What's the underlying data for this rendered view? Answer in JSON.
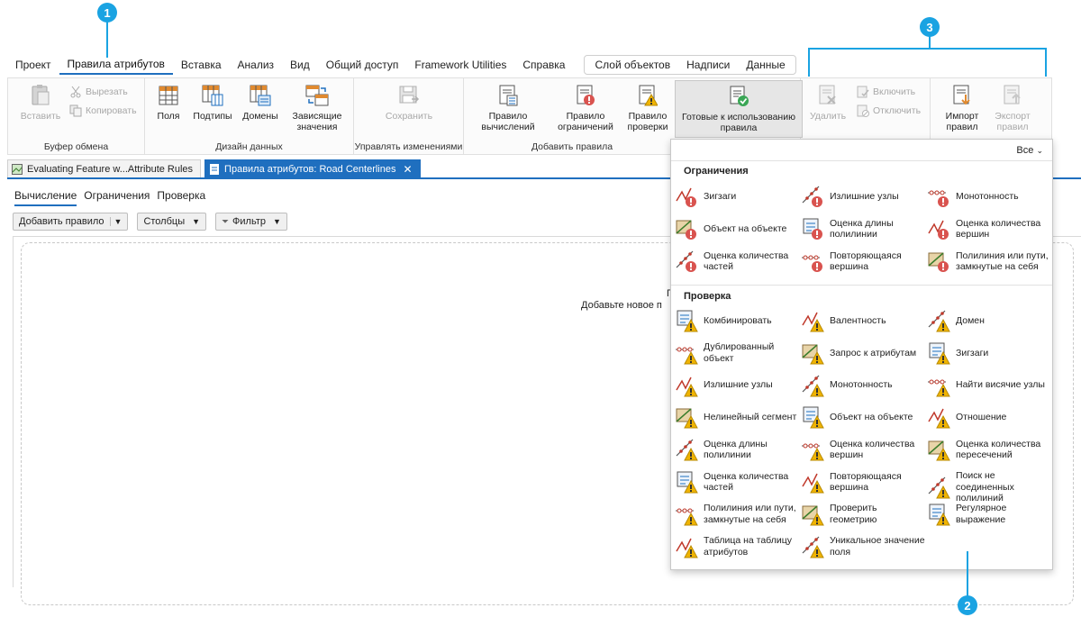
{
  "callouts": [
    "1",
    "2",
    "3"
  ],
  "menu": {
    "items": [
      "Проект",
      "Правила атрибутов",
      "Вставка",
      "Анализ",
      "Вид",
      "Общий доступ",
      "Framework Utilities",
      "Справка"
    ],
    "contextual": [
      "Слой объектов",
      "Надписи",
      "Данные"
    ]
  },
  "ribbon": {
    "clipboard": {
      "label": "Буфер обмена",
      "paste": "Вставить",
      "cut": "Вырезать",
      "copy": "Копировать"
    },
    "data_design": {
      "label": "Дизайн данных",
      "fields": "Поля",
      "subtypes": "Подтипы",
      "domains": "Домены",
      "dependent": "Зависящие значения"
    },
    "manage": {
      "label": "Управлять изменениями",
      "save": "Сохранить"
    },
    "add_rules": {
      "label": "Добавить правила",
      "calc": "Правило вычислений",
      "constraint": "Правило ограничений",
      "validation": "Правило проверки",
      "ready": "Готовые к использованию правила"
    },
    "edit": {
      "delete": "Удалить",
      "enable": "Включить",
      "disable": "Отключить"
    },
    "io": {
      "import": "Импорт правил",
      "export": "Экспорт правил"
    }
  },
  "doc_tabs": [
    "Evaluating Feature w...Attribute Rules",
    "Правила атрибутов: Road Centerlines"
  ],
  "sub_tabs": [
    "Вычисление",
    "Ограничения",
    "Проверка"
  ],
  "toolbar": {
    "add_rule": "Добавить правило",
    "columns": "Столбцы",
    "filter": "Фильтр"
  },
  "empty_msg": [
    "П",
    "Добавьте новое п"
  ],
  "gallery": {
    "filter": "Все",
    "sections": [
      {
        "title": "Ограничения",
        "items": [
          "Зигзаги",
          "Излишние узлы",
          "Монотонность",
          "Объект на объекте",
          "Оценка длины полилинии",
          "Оценка количества вершин",
          "Оценка количества частей",
          "Повторяющаяся вершина",
          "Полилиния или пути, замкнутые на себя"
        ]
      },
      {
        "title": "Проверка",
        "items": [
          "Комбинировать",
          "Валентность",
          "Домен",
          "Дублированный объект",
          "Запрос к атрибутам",
          "Зигзаги",
          "Излишние узлы",
          "Монотонность",
          "Найти висячие узлы",
          "Нелинейный сегмент",
          "Объект на объекте",
          "Отношение",
          "Оценка длины полилинии",
          "Оценка количества вершин",
          "Оценка количества пересечений",
          "Оценка количества частей",
          "Повторяющаяся вершина",
          "Поиск не соединенных полилиний",
          "Полилиния или пути, замкнутые на себя",
          "Проверить геометрию",
          "Регулярное выражение",
          "Таблица на таблицу атрибутов",
          "Уникальное значение поля"
        ]
      }
    ]
  },
  "colors": {
    "accent": "#1f6fbf",
    "callout": "#1aa3e2",
    "error": "#d9534f",
    "warning": "#f0b400"
  }
}
